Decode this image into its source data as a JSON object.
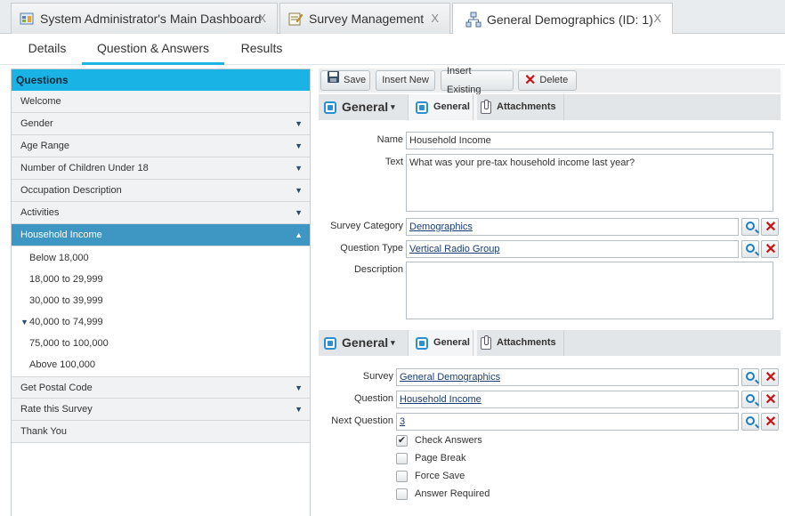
{
  "doc_tabs": [
    {
      "label": "System Administrator's Main Dashboard",
      "close": "X",
      "icon": "dashboard-icon"
    },
    {
      "label": "Survey Management",
      "close": "X",
      "icon": "edit-notepad-icon"
    },
    {
      "label": "General Demographics (ID: 1)",
      "close": "X",
      "icon": "hierarchy-icon"
    }
  ],
  "sub_tabs": [
    "Details",
    "Question & Answers",
    "Results"
  ],
  "questions": {
    "header": "Questions",
    "items": [
      {
        "label": "Welcome",
        "arrow": ""
      },
      {
        "label": "Gender",
        "arrow": "▼"
      },
      {
        "label": "Age Range",
        "arrow": "▼"
      },
      {
        "label": "Number of Children Under 18",
        "arrow": "▼"
      },
      {
        "label": "Occupation Description",
        "arrow": "▼"
      },
      {
        "label": "Activities",
        "arrow": "▼"
      },
      {
        "label": "Household Income",
        "arrow": "▲"
      }
    ],
    "answers": [
      {
        "label": "Below 18,000",
        "marker": ""
      },
      {
        "label": "18,000 to 29,999",
        "marker": ""
      },
      {
        "label": "30,000 to 39,999",
        "marker": ""
      },
      {
        "label": "40,000 to 74,999",
        "marker": "▼"
      },
      {
        "label": "75,000 to 100,000",
        "marker": ""
      },
      {
        "label": "Above 100,000",
        "marker": ""
      }
    ],
    "items_after": [
      {
        "label": "Get Postal Code",
        "arrow": "▼"
      },
      {
        "label": "Rate this Survey",
        "arrow": "▼"
      },
      {
        "label": "Thank You",
        "arrow": ""
      }
    ]
  },
  "toolbar": {
    "save": "Save",
    "insert_new": "Insert New",
    "insert_existing": "Insert Existing",
    "delete": "Delete"
  },
  "section1": {
    "title": "General",
    "caret": "▾",
    "tab_general": "General",
    "tab_attachments": "Attachments",
    "name_label": "Name",
    "name_value": "Household Income",
    "text_label": "Text",
    "text_value": "What was your pre-tax household income last year?",
    "category_label": "Survey Category",
    "category_value": "Demographics",
    "qtype_label": "Question Type",
    "qtype_value": "Vertical Radio Group",
    "description_label": "Description",
    "description_value": ""
  },
  "section2": {
    "title": "General",
    "caret": "▾",
    "tab_general": "General",
    "tab_attachments": "Attachments",
    "survey_label": "Survey",
    "survey_value": "General Demographics",
    "question_label": "Question",
    "question_value": "Household Income",
    "next_label": "Next Question",
    "next_value": "3"
  },
  "checkboxes": [
    {
      "label": "Check Answers",
      "checked": true,
      "mark": "✔"
    },
    {
      "label": "Page Break",
      "checked": false,
      "mark": ""
    },
    {
      "label": "Force Save",
      "checked": false,
      "mark": ""
    },
    {
      "label": "Answer Required",
      "checked": false,
      "mark": ""
    }
  ],
  "colors": {
    "accent": "#1ab3e6",
    "selected_row": "#3e96c2",
    "delete_red": "#cc1111"
  }
}
